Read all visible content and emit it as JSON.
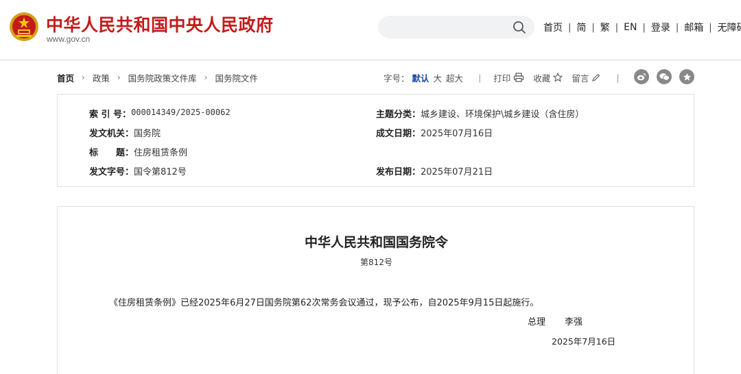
{
  "header": {
    "site_title": "中华人民共和国中央人民政府",
    "site_url": "www.gov.cn",
    "search_placeholder": "",
    "nav": [
      "首页",
      "简",
      "繁",
      "EN",
      "登录",
      "邮箱",
      "无障碍"
    ],
    "nav_separator": "|"
  },
  "breadcrumb": {
    "items": [
      "首页",
      "政策",
      "国务院政策文件库",
      "国务院文件"
    ],
    "separator": "›"
  },
  "tools": {
    "font_size_label": "字号：",
    "font_options": [
      "默认",
      "大",
      "超大"
    ],
    "print_label": "打印",
    "favorite_label": "收藏",
    "comment_label": "留言",
    "divider": "|"
  },
  "social_icons": [
    "weibo-icon",
    "wechat-icon",
    "star-icon"
  ],
  "info": {
    "index_label": "索 引 号：",
    "index_value": "000014349/2025-00062",
    "category_label": "主题分类：",
    "category_value": "城乡建设、环境保护\\城乡建设（含住房）",
    "issuer_label": "发文机关：",
    "issuer_value": "国务院",
    "written_label": "成文日期：",
    "written_value": "2025年07月16日",
    "title_label": "标　　题：",
    "title_value": "住房租赁条例",
    "docnum_label": "发文字号：",
    "docnum_value": "国令第812号",
    "published_label": "发布日期：",
    "published_value": "2025年07月21日"
  },
  "document": {
    "title": "中华人民共和国国务院令",
    "number": "第812号",
    "paragraph": "《住房租赁条例》已经2025年6月27日国务院第62次常务会议通过，现予公布，自2025年9月15日起施行。",
    "signer_title": "总理",
    "signer_name": "李强",
    "date": "2025年7月16日"
  },
  "colors": {
    "brand_red": "#c31b1b",
    "accent_blue": "#1a4aa5",
    "border": "#e0e0e0"
  }
}
